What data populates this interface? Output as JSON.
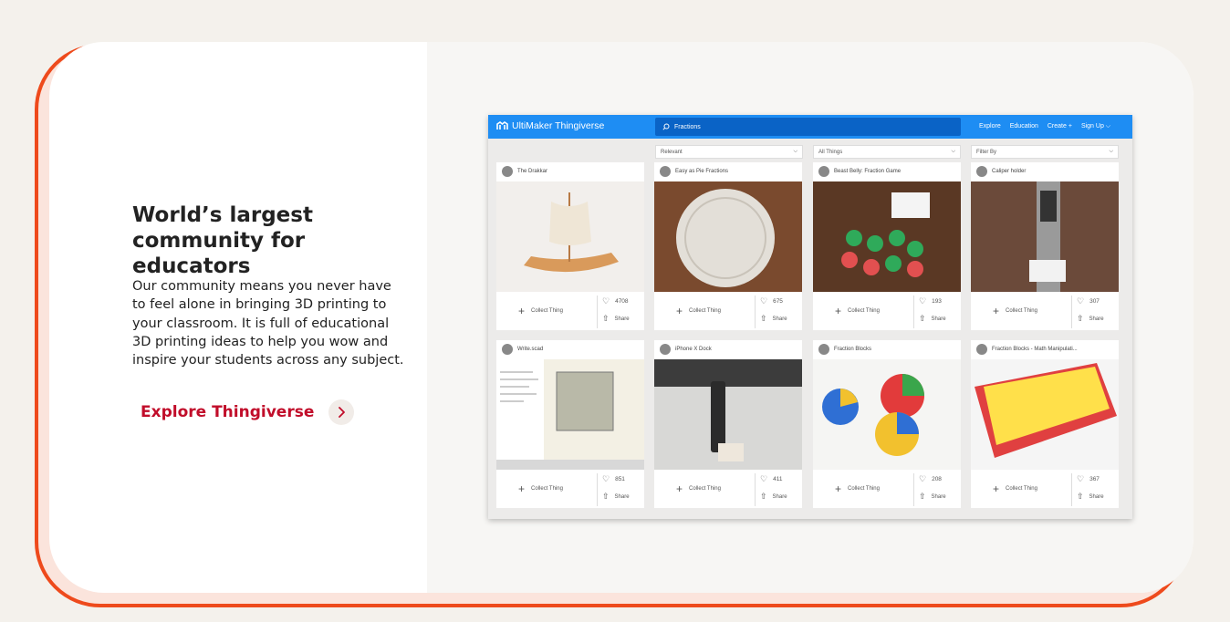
{
  "section": {
    "heading_line1": "World’s largest",
    "heading_line2": "community for educators",
    "body": "Our community means you never have to feel alone in bringing 3D printing to your classroom. It is full of educational 3D printing ideas to help you wow and inspire your students across any subject.",
    "cta_label": "Explore Thingiverse"
  },
  "colors": {
    "accent": "#c10d2a",
    "frame": "#ee4a1c",
    "topbar": "#1e8df3"
  },
  "screenshot": {
    "brand": "UltiMaker Thingiverse",
    "search_value": "Fractions",
    "nav": [
      "Explore",
      "Education",
      "Create",
      "Sign Up"
    ],
    "filters": [
      "Relevant",
      "All Things",
      "Filter By"
    ],
    "collect_label": "Collect Thing",
    "share_label": "Share",
    "things": [
      {
        "title": "The Drakkar",
        "likes": "4708"
      },
      {
        "title": "Easy as Pie Fractions",
        "likes": "675"
      },
      {
        "title": "Beast Belly: Fraction Game",
        "likes": "193"
      },
      {
        "title": "Caliper holder",
        "likes": "307"
      },
      {
        "title": "Write.scad",
        "likes": "851"
      },
      {
        "title": "iPhone X Dock",
        "likes": "411"
      },
      {
        "title": "Fraction Blocks",
        "likes": "208"
      },
      {
        "title": "Fraction Blocks - Math Manipulati...",
        "likes": "367"
      }
    ]
  }
}
